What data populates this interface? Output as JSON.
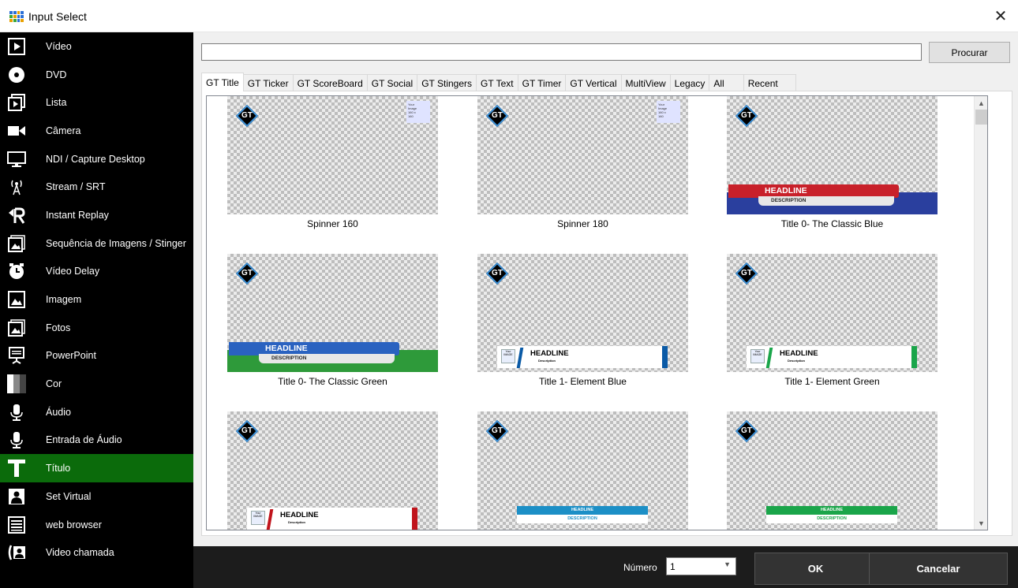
{
  "window": {
    "title": "Input Select"
  },
  "sidebar": {
    "items": [
      {
        "label": "Vídeo",
        "icon": "video-icon"
      },
      {
        "label": "DVD",
        "icon": "dvd-icon"
      },
      {
        "label": "Lista",
        "icon": "list-icon"
      },
      {
        "label": "Câmera",
        "icon": "camera-icon"
      },
      {
        "label": "NDI / Capture Desktop",
        "icon": "monitor-icon"
      },
      {
        "label": "Stream / SRT",
        "icon": "antenna-icon"
      },
      {
        "label": "Instant Replay",
        "icon": "replay-icon"
      },
      {
        "label": "Sequência de Imagens / Stinger",
        "icon": "image-sequence-icon"
      },
      {
        "label": "Vídeo Delay",
        "icon": "delay-clock-icon"
      },
      {
        "label": "Imagem",
        "icon": "image-icon"
      },
      {
        "label": "Fotos",
        "icon": "photos-icon"
      },
      {
        "label": "PowerPoint",
        "icon": "presentation-icon"
      },
      {
        "label": "Cor",
        "icon": "color-icon"
      },
      {
        "label": "Áudio",
        "icon": "microphone-icon"
      },
      {
        "label": "Entrada de Áudio",
        "icon": "audio-input-icon"
      },
      {
        "label": "Título",
        "icon": "title-t-icon"
      },
      {
        "label": "Set Virtual",
        "icon": "virtual-set-icon"
      },
      {
        "label": "web browser",
        "icon": "browser-icon"
      },
      {
        "label": "Video chamada",
        "icon": "video-call-icon"
      }
    ],
    "active_index": 15
  },
  "search": {
    "value": "",
    "browse_label": "Procurar"
  },
  "tabs": [
    "GT Title",
    "GT Ticker",
    "GT ScoreBoard",
    "GT Social",
    "GT Stingers",
    "GT Text",
    "GT Timer",
    "GT Vertical",
    "MultiView",
    "Legacy",
    "All",
    "Recent"
  ],
  "active_tab": 0,
  "gt_logo_text": "GT",
  "headline_text": "HEADLINE",
  "description_text": "DESCRIPTION",
  "description_small": "Description",
  "image_placeholder": "Your IMAGE",
  "spinner_tag": [
    "Your",
    "Image",
    "160 x",
    "160"
  ],
  "titles": [
    {
      "label": "Spinner 160",
      "style": "spinner"
    },
    {
      "label": "Spinner 180",
      "style": "spinner"
    },
    {
      "label": "Title 0- The Classic Blue",
      "style": "classic",
      "color": "#c8202a",
      "bg": "#2a3f9e"
    },
    {
      "label": "Title 0- The Classic Green",
      "style": "classic",
      "color": "#2a62c0",
      "bg": "#2e9a3a"
    },
    {
      "label": "Title 1- Element Blue",
      "style": "element",
      "color": "#0a5aa6"
    },
    {
      "label": "Title 1- Element Green",
      "style": "element",
      "color": "#1aa54a"
    },
    {
      "label": "",
      "style": "element",
      "color": "#c0141c"
    },
    {
      "label": "",
      "style": "flat",
      "color": "#1c8fc6"
    },
    {
      "label": "",
      "style": "flat",
      "color": "#1aa54a"
    }
  ],
  "footer": {
    "number_label": "Número",
    "number_value": "1",
    "ok_label": "OK",
    "cancel_label": "Cancelar"
  }
}
